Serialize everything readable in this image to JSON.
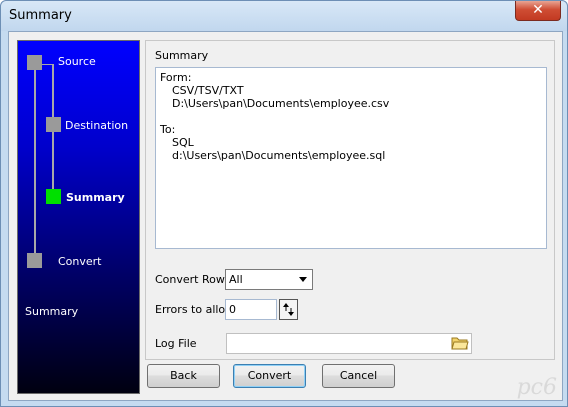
{
  "window": {
    "title": "Summary",
    "close_glyph": "✕"
  },
  "wizard": {
    "steps": [
      {
        "label": "Source",
        "state": "done"
      },
      {
        "label": "Destination",
        "state": "done"
      },
      {
        "label": "Summary",
        "state": "active"
      },
      {
        "label": "Convert",
        "state": "pending"
      }
    ],
    "caption": "Summary",
    "colors": {
      "active_step": "#00e000",
      "inactive_step": "#9a9a9a",
      "panel_top": "#0000ff",
      "panel_bottom": "#000010"
    }
  },
  "summary_group": {
    "title": "Summary",
    "lines": [
      "Form:",
      "CSV/TSV/TXT",
      "D:\\Users\\pan\\Documents\\employee.csv",
      "",
      "To:",
      "SQL",
      "d:\\Users\\pan\\Documents\\employee.sql"
    ]
  },
  "options": {
    "convert_rows_label": "Convert Rows",
    "convert_rows_value": "All",
    "errors_label": "Errors to allow",
    "errors_value": "0",
    "log_file_label": "Log File",
    "log_file_value": ""
  },
  "buttons": {
    "back": "Back",
    "convert": "Convert",
    "cancel": "Cancel"
  },
  "watermark": "pc6"
}
